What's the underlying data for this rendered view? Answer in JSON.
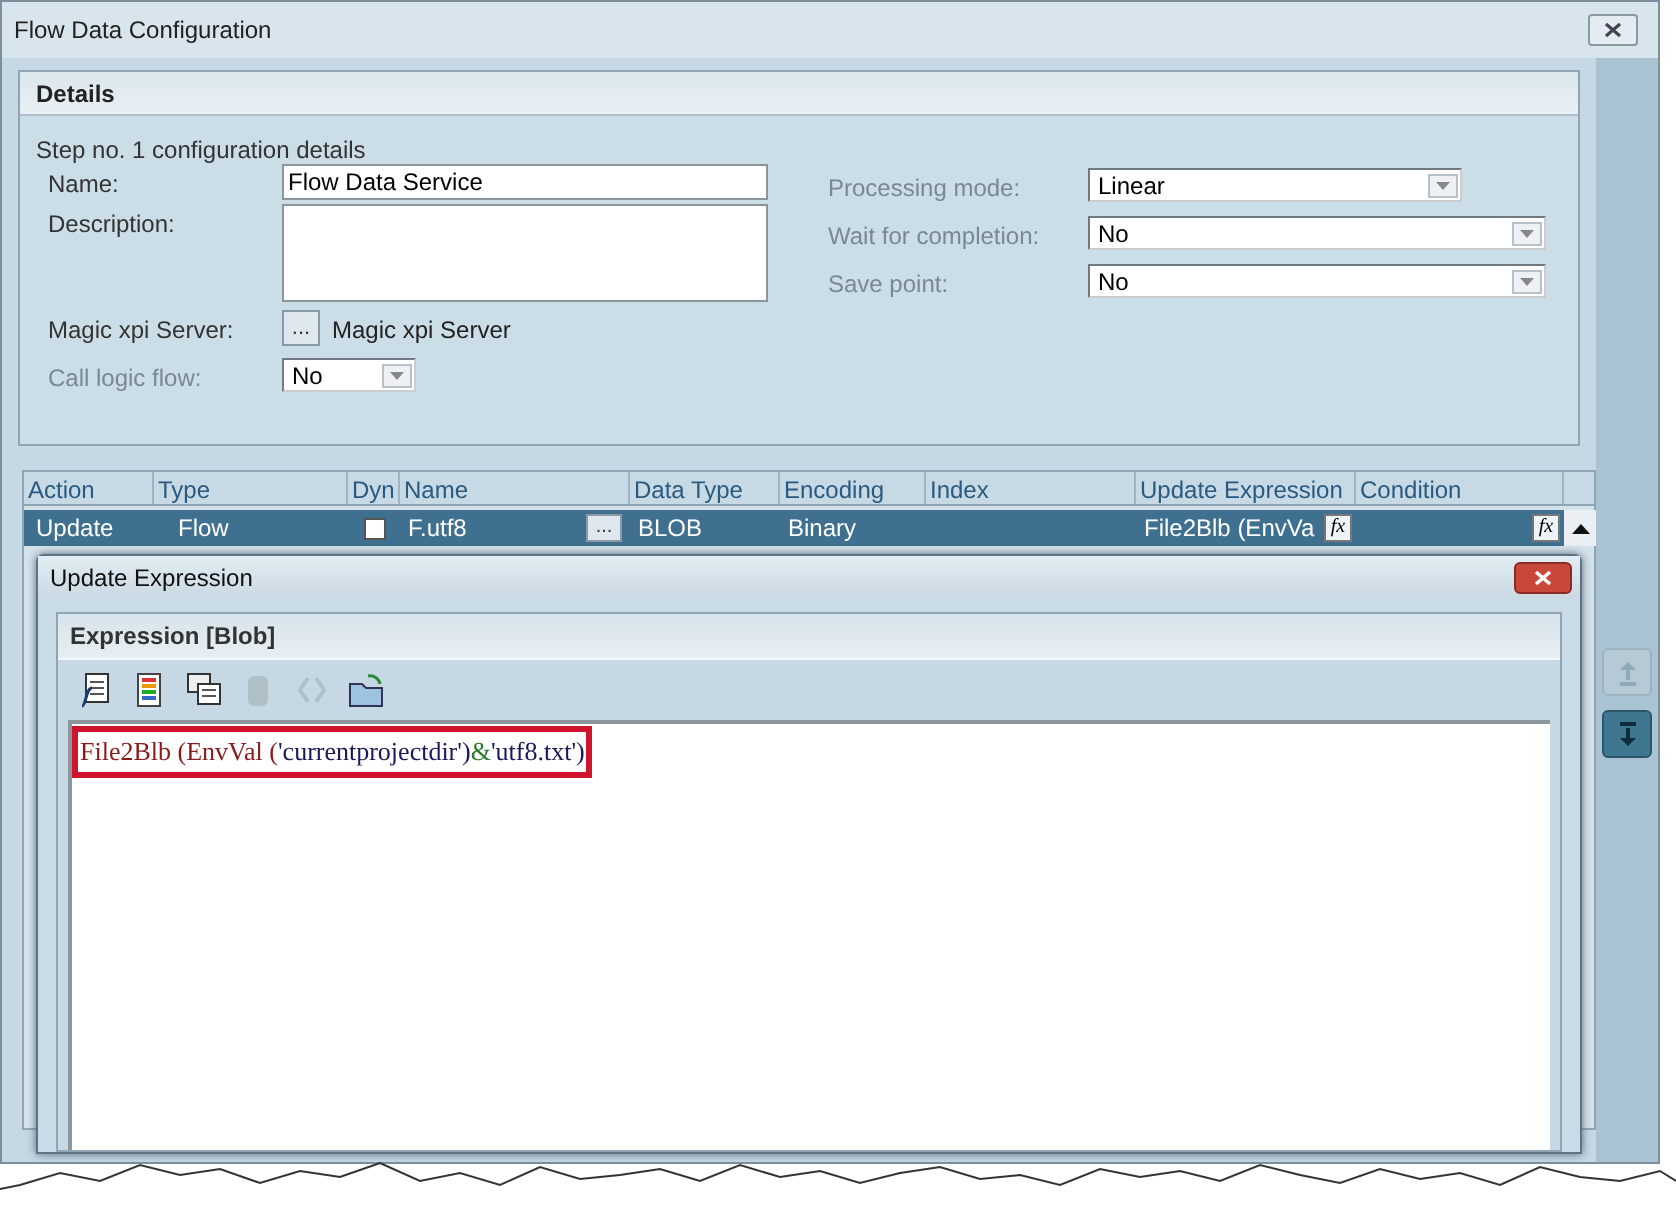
{
  "window": {
    "title": "Flow Data Configuration"
  },
  "details": {
    "header": "Details",
    "subtitle": "Step no. 1 configuration details",
    "left_fields": [
      {
        "label": "Name:",
        "kind": "text",
        "value": "Flow Data Service",
        "disabled": false
      },
      {
        "label": "Description:",
        "kind": "textarea",
        "disabled": false
      },
      {
        "label": "Magic xpi Server:",
        "kind": "picker",
        "button": "...",
        "value": "Magic xpi Server",
        "disabled": false
      },
      {
        "label": "Call logic flow:",
        "kind": "dropdown",
        "value": "No",
        "disabled": true
      }
    ],
    "right_fields": [
      {
        "label": "Processing mode:",
        "kind": "dropdown",
        "value": "Linear",
        "disabled": true
      },
      {
        "label": "Wait for completion:",
        "kind": "dropdown",
        "value": "No",
        "disabled": true
      },
      {
        "label": "Save point:",
        "kind": "dropdown",
        "value": "No",
        "disabled": true
      }
    ]
  },
  "table": {
    "columns": [
      "Action",
      "Type",
      "Dyn",
      "Name",
      "Data Type",
      "Encoding",
      "Index",
      "Update Expression",
      "Condition"
    ],
    "rows": [
      {
        "action": "Update",
        "type": "Flow",
        "dyn": false,
        "name": "F.utf8",
        "name_button": "...",
        "data_type": "BLOB",
        "encoding": "Binary",
        "update_expression": "File2Blb (EnvVa",
        "expression_button": "fx",
        "condition_button": "fx",
        "selected": true
      }
    ]
  },
  "move_buttons": [
    {
      "kind": "up",
      "disabled": true
    },
    {
      "kind": "down",
      "disabled": false
    }
  ],
  "dialog": {
    "title": "Update Expression",
    "panel_title": "Expression [Blob]",
    "toolbar": [
      {
        "kind": "function",
        "disabled": false
      },
      {
        "kind": "list",
        "disabled": false
      },
      {
        "kind": "copy",
        "disabled": false
      },
      {
        "kind": "clip",
        "disabled": true
      },
      {
        "kind": "brackets",
        "disabled": true
      },
      {
        "kind": "open",
        "disabled": false
      }
    ],
    "expression": [
      {
        "text": "File2Blb (",
        "kind": "function"
      },
      {
        "text": "EnvVal (",
        "kind": "function"
      },
      {
        "text": "'currentprojectdir')",
        "kind": "string"
      },
      {
        "text": "&",
        "kind": "operator"
      },
      {
        "text": "'utf8.txt')",
        "kind": "string"
      }
    ]
  }
}
